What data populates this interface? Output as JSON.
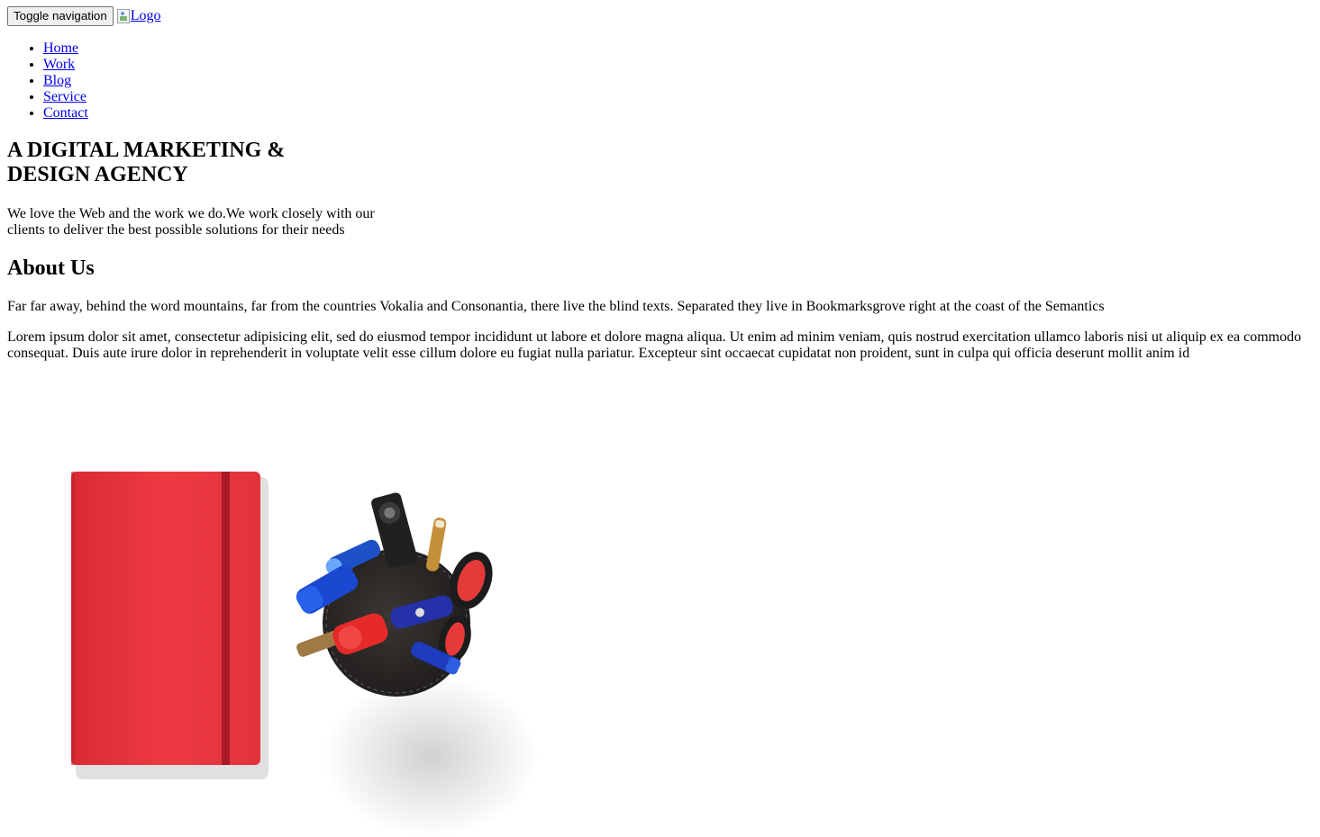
{
  "header": {
    "toggle_label": "Toggle navigation",
    "logo_alt": "Logo"
  },
  "nav": {
    "items": [
      "Home",
      "Work",
      "Blog",
      "Service",
      "Contact"
    ]
  },
  "hero": {
    "title_line1": "A DIGITAL MARKETING &",
    "title_line2": "DESIGN AGENCY",
    "text": "We love the Web and the work we do.We work closely with our clients to deliver the best possible solutions for their needs"
  },
  "about": {
    "title": "About Us",
    "p1": "Far far away, behind the word mountains, far from the countries Vokalia and Consonantia, there live the blind texts. Separated they live in Bookmarksgrove right at the coast of the Semantics",
    "p2": "Lorem ipsum dolor sit amet, consectetur adipisicing elit, sed do eiusmod tempor incididunt ut labore et dolore magna aliqua. Ut enim ad minim veniam, quis nostrud exercitation ullamco laboris nisi ut aliquip ex ea commodo consequat. Duis aute irure dolor in reprehenderit in voluptate velit esse cillum dolore eu fugiat nulla pariatur. Excepteur sint occaecat cupidatat non proident, sunt in culpa qui officia deserunt mollit anim id"
  },
  "colors": {
    "link": "#0000ee",
    "notebook": "#e8333a",
    "band": "#a8192a"
  }
}
